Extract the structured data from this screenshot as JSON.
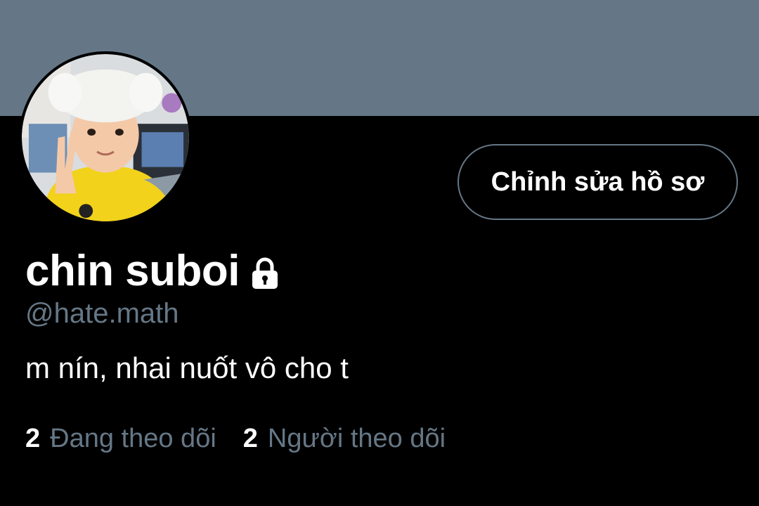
{
  "colors": {
    "banner": "#657786",
    "background": "#000000",
    "secondary_text": "#657786",
    "primary_text": "#ffffff"
  },
  "profile": {
    "display_name": "chin suboi",
    "protected_icon": "lock-icon",
    "handle": "@hate.math",
    "bio": "m nín, nhai nuốt vô cho t",
    "avatar_icon": "profile-photo"
  },
  "actions": {
    "edit_profile_label": "Chỉnh sửa hồ sơ"
  },
  "stats": {
    "following": {
      "count": "2",
      "label": "Đang theo dõi"
    },
    "followers": {
      "count": "2",
      "label": "Người theo dõi"
    }
  }
}
